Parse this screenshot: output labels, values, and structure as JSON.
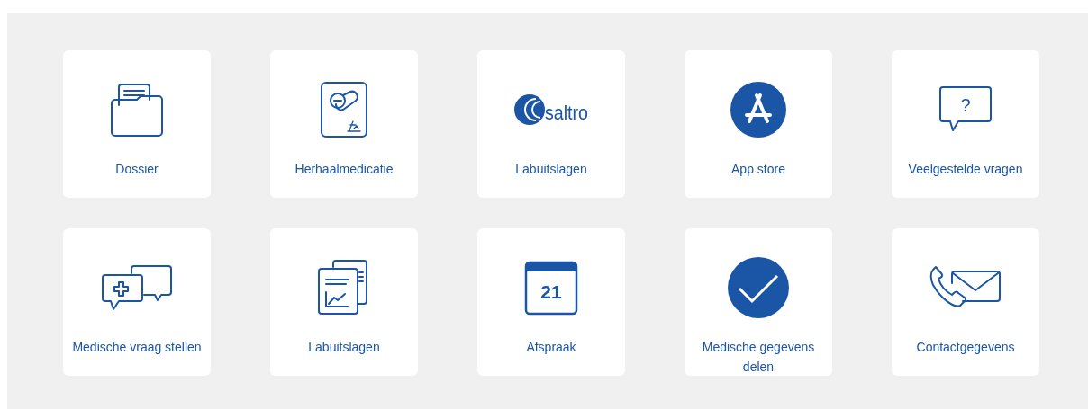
{
  "tiles": [
    {
      "kind": "folder",
      "label": "Dossier"
    },
    {
      "kind": "prescription",
      "label": "Herhaalmedicatie"
    },
    {
      "kind": "logo",
      "icon_text": "saltro",
      "label": "Labuitslagen"
    },
    {
      "kind": "appstore",
      "label": "App store"
    },
    {
      "kind": "question",
      "icon_text": "?",
      "label": "Veelgestelde vragen"
    },
    {
      "kind": "chat",
      "label": "Medische vraag stellen"
    },
    {
      "kind": "reports",
      "label": "Labuitslagen"
    },
    {
      "kind": "calendar",
      "icon_text": "21",
      "label": "Afspraak"
    },
    {
      "kind": "check",
      "label": "Medische gegevens delen"
    },
    {
      "kind": "contact",
      "label": "Contactgegevens"
    }
  ]
}
